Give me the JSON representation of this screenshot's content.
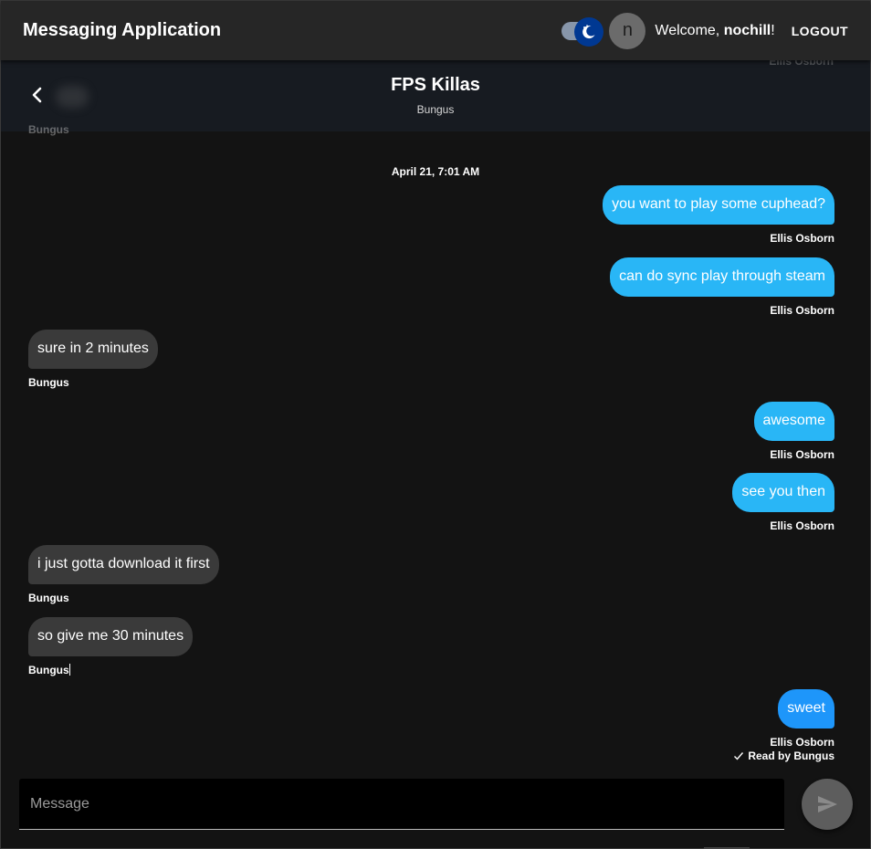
{
  "appbar": {
    "title": "Messaging Application",
    "welcome_prefix": "Welcome, ",
    "username": "nochill",
    "welcome_suffix": "!",
    "avatar_letter": "n",
    "logout_label": "LOGOUT",
    "theme_toggle": "dark-mode-on"
  },
  "conversation": {
    "title": "FPS Killas",
    "subtitle": "Bungus",
    "ghost_top_right": "Ellis Osborn",
    "ghost_top_left": "Bungus",
    "date_label": "April 21, 7:01 AM"
  },
  "messages": [
    {
      "text": "you want to play some cuphead?",
      "sender": "Ellis Osborn",
      "direction": "out"
    },
    {
      "text": "can do sync play through steam",
      "sender": "Ellis Osborn",
      "direction": "out"
    },
    {
      "text": "sure in 2 minutes",
      "sender": "Bungus",
      "direction": "in"
    },
    {
      "text": "awesome",
      "sender": "Ellis Osborn",
      "direction": "out"
    },
    {
      "text": "see you then",
      "sender": "Ellis Osborn",
      "direction": "out"
    },
    {
      "text": "i just gotta download it first",
      "sender": "Bungus",
      "direction": "in"
    },
    {
      "text": "so give me 30 minutes",
      "sender": "Bungus",
      "direction": "in"
    },
    {
      "text": "sweet",
      "sender": "Ellis Osborn",
      "direction": "out"
    }
  ],
  "read_receipt": "Read by Bungus",
  "composer": {
    "placeholder": "Message",
    "value": ""
  },
  "colors": {
    "outgoing_bubble": "#29b6f6",
    "outgoing_bubble_last": "#1e96fa",
    "incoming_bubble": "#3a3a3a",
    "appbar": "#262626",
    "background": "#131313"
  }
}
